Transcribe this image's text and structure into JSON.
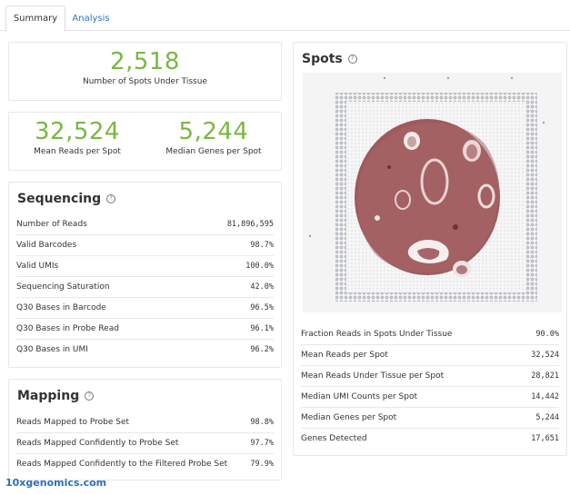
{
  "tabs": {
    "summary": "Summary",
    "analysis": "Analysis"
  },
  "spots_under_tissue": {
    "value": "2,518",
    "label": "Number of Spots Under Tissue"
  },
  "mean_reads": {
    "value": "32,524",
    "label": "Mean Reads per Spot"
  },
  "median_genes": {
    "value": "5,244",
    "label": "Median Genes per Spot"
  },
  "sequencing": {
    "title": "Sequencing",
    "rows": [
      {
        "label": "Number of Reads",
        "value": "81,896,595"
      },
      {
        "label": "Valid Barcodes",
        "value": "98.7%"
      },
      {
        "label": "Valid UMIs",
        "value": "100.0%"
      },
      {
        "label": "Sequencing Saturation",
        "value": "42.0%"
      },
      {
        "label": "Q30 Bases in Barcode",
        "value": "96.5%"
      },
      {
        "label": "Q30 Bases in Probe Read",
        "value": "96.1%"
      },
      {
        "label": "Q30 Bases in UMI",
        "value": "96.2%"
      }
    ]
  },
  "mapping": {
    "title": "Mapping",
    "rows": [
      {
        "label": "Reads Mapped to Probe Set",
        "value": "98.8%"
      },
      {
        "label": "Reads Mapped Confidently to Probe Set",
        "value": "97.7%"
      },
      {
        "label": "Reads Mapped Confidently to the Filtered Probe Set",
        "value": "79.9%"
      }
    ]
  },
  "spots": {
    "title": "Spots",
    "rows": [
      {
        "label": "Fraction Reads in Spots Under Tissue",
        "value": "90.0%"
      },
      {
        "label": "Mean Reads per Spot",
        "value": "32,524"
      },
      {
        "label": "Mean Reads Under Tissue per Spot",
        "value": "28,821"
      },
      {
        "label": "Median UMI Counts per Spot",
        "value": "14,442"
      },
      {
        "label": "Median Genes per Spot",
        "value": "5,244"
      },
      {
        "label": "Genes Detected",
        "value": "17,651"
      }
    ]
  },
  "footer": "10xgenomics.com",
  "colors": {
    "accent_green": "#78b843",
    "link_blue": "#2a74c6",
    "tissue": "#9e5a5d"
  }
}
